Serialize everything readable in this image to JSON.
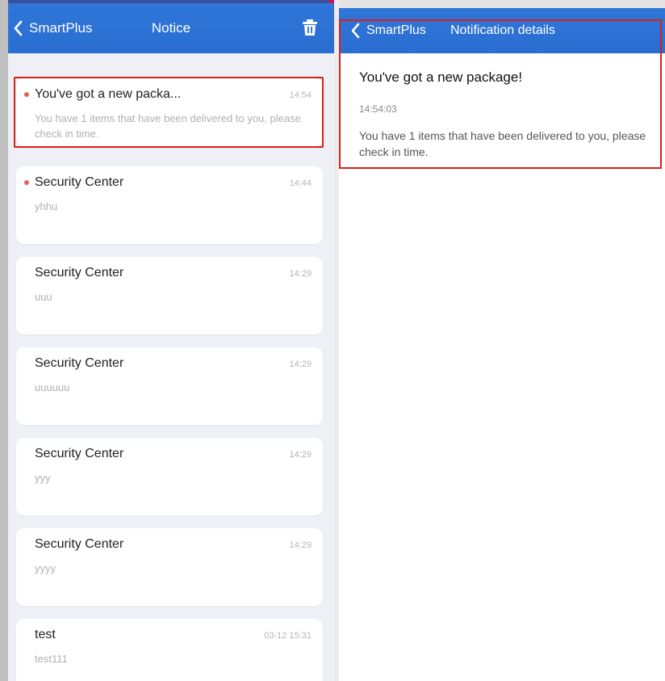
{
  "left": {
    "nav": {
      "back_label": "SmartPlus",
      "title": "Notice"
    },
    "notifications": [
      {
        "title": "You've got a new packa...",
        "time": "14:54",
        "body": "You have 1 items that have been delivered to you, please check in time.",
        "unread": true
      },
      {
        "title": "Security Center",
        "time": "14:44",
        "body": "yhhu",
        "unread": true
      },
      {
        "title": "Security Center",
        "time": "14:29",
        "body": "uuu",
        "unread": false
      },
      {
        "title": "Security Center",
        "time": "14:29",
        "body": "uuuuuu",
        "unread": false
      },
      {
        "title": "Security Center",
        "time": "14:29",
        "body": "yyy",
        "unread": false
      },
      {
        "title": "Security Center",
        "time": "14:29",
        "body": "yyyy",
        "unread": false
      },
      {
        "title": "test",
        "time": "03-12 15:31",
        "body": "test111",
        "unread": false
      }
    ]
  },
  "right": {
    "nav": {
      "back_label": "SmartPlus",
      "title": "Notification details"
    },
    "detail": {
      "title": "You've got a new package!",
      "time": "14:54:03",
      "body": "You have 1 items that have been delivered to you, please check in time."
    }
  },
  "colors": {
    "nav_blue": "#2b6dd0",
    "unread_dot": "#e06060",
    "highlight": "#d9201b",
    "list_bg": "#eef0f6"
  },
  "icons": [
    "chevron-left-icon",
    "trash-icon",
    "unread-dot-icon"
  ]
}
